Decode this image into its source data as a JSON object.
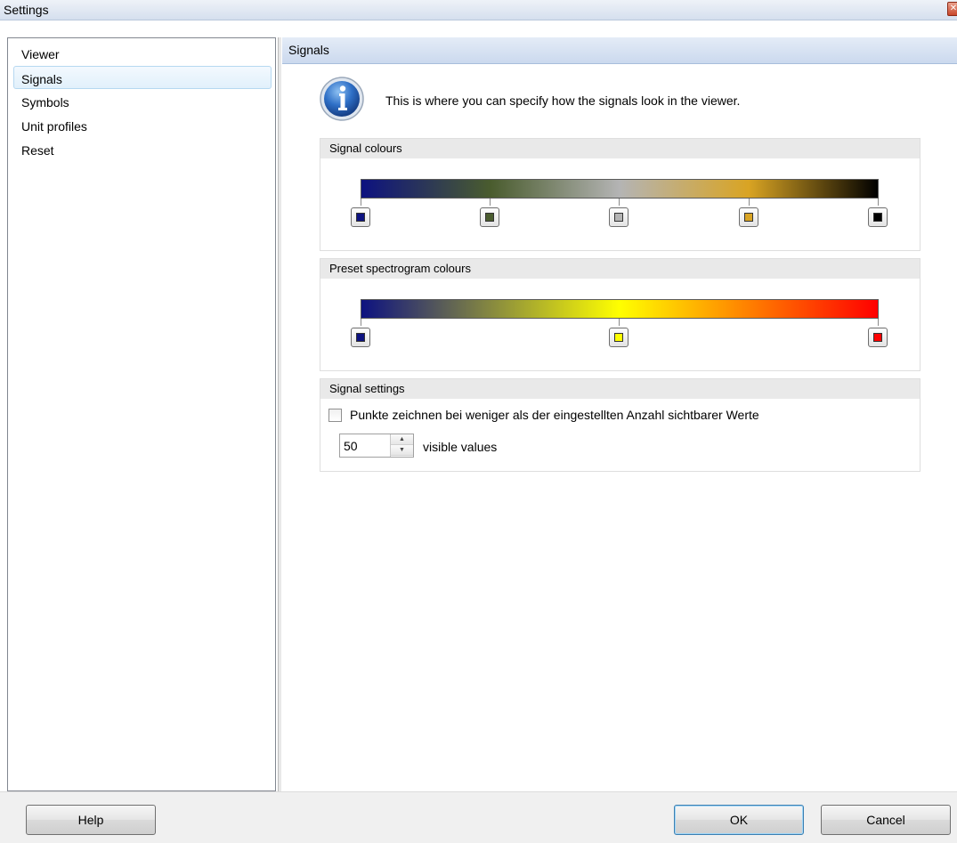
{
  "window": {
    "title": "Settings",
    "close_label": "✕"
  },
  "sidebar": {
    "items": [
      {
        "label": "Viewer",
        "selected": false
      },
      {
        "label": "Signals",
        "selected": true
      },
      {
        "label": "Symbols",
        "selected": false
      },
      {
        "label": "Unit profiles",
        "selected": false
      },
      {
        "label": "Reset",
        "selected": false
      }
    ]
  },
  "main": {
    "header": "Signals",
    "info_text": "This is where you can specify how the signals look in the viewer.",
    "signal_colours": {
      "title": "Signal colours",
      "stops": [
        "#0d1280",
        "#4a5c2e",
        "#b4b4b4",
        "#d9a423",
        "#000000"
      ]
    },
    "spectrogram_colours": {
      "title": "Preset spectrogram colours",
      "stops": [
        "#0d1280",
        "#ffff00",
        "#ff0000"
      ]
    },
    "signal_settings": {
      "title": "Signal settings",
      "checkbox_label": "Punkte zeichnen bei weniger als der eingestellten Anzahl sichtbarer Werte",
      "checkbox_checked": false,
      "visible_values": "50",
      "visible_values_label": "visible values"
    }
  },
  "footer": {
    "help_label": "Help",
    "ok_label": "OK",
    "cancel_label": "Cancel"
  }
}
